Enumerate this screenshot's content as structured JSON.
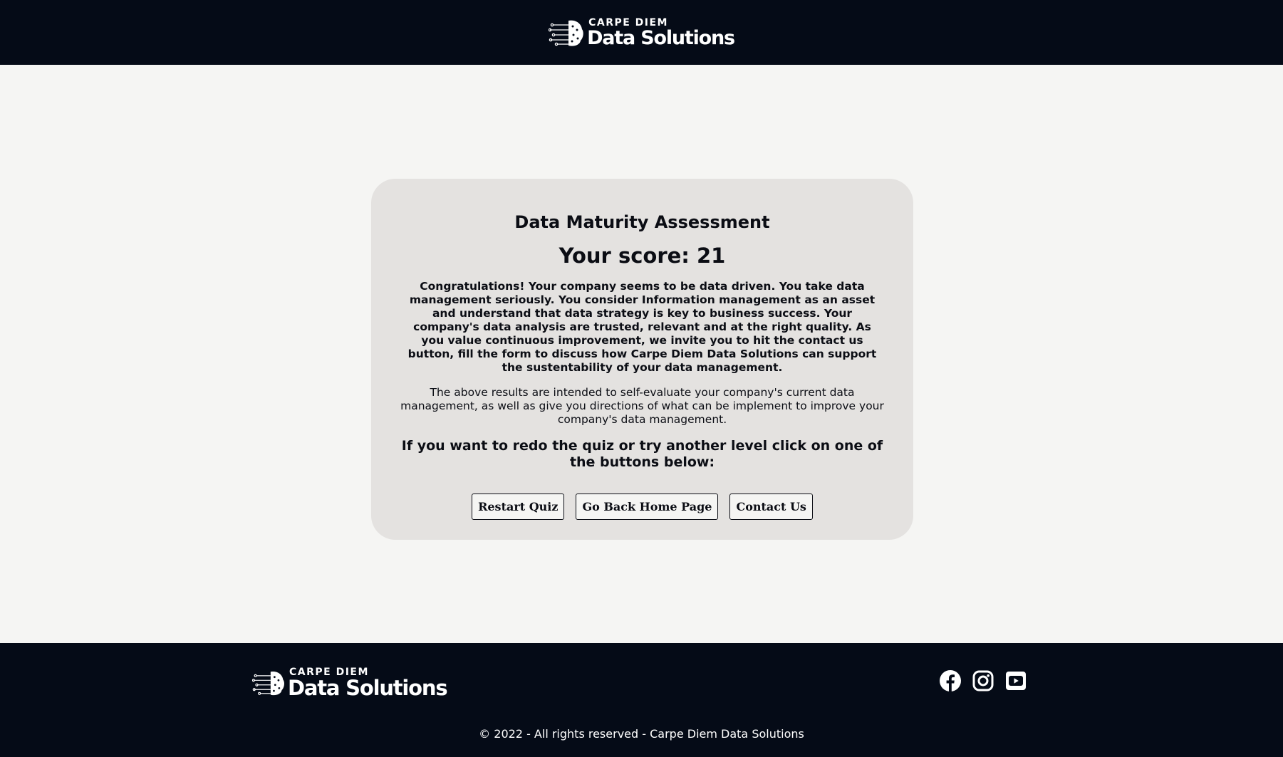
{
  "header": {
    "logo": {
      "small": "CARPE DIEM",
      "big": "Data Solutions"
    }
  },
  "card": {
    "title": "Data Maturity Assessment",
    "score": "Your score: 21",
    "congrats": "Congratulations! Your company seems to be data driven. You take data management seriously. You consider Information management as an asset and understand that data strategy is key to business success. Your company's data analysis are trusted, relevant and at the right quality. As you value continuous improvement, we invite you to hit the contact us button, fill the form to discuss how Carpe Diem Data Solutions can support the sustentability of your data management.",
    "disclaimer": "The above results are intended to self-evaluate your company's current data management, as well as give you directions of what can be implement to improve your company's data management.",
    "redo": "If you want to redo the quiz or try another level click on one of the buttons below:",
    "buttons": {
      "restart": "Restart Quiz",
      "home": "Go Back Home Page",
      "contact": "Contact Us"
    }
  },
  "footer": {
    "logo": {
      "small": "CARPE DIEM",
      "big": "Data Solutions"
    },
    "social": [
      "facebook-icon",
      "instagram-icon",
      "youtube-icon"
    ],
    "copyright": "© 2022 - All rights reserved - Carpe Diem Data Solutions"
  },
  "colors": {
    "dark": "#050b17",
    "background": "#f5f5f3",
    "card": "#e4e2e0",
    "text": "#0b0d14"
  }
}
